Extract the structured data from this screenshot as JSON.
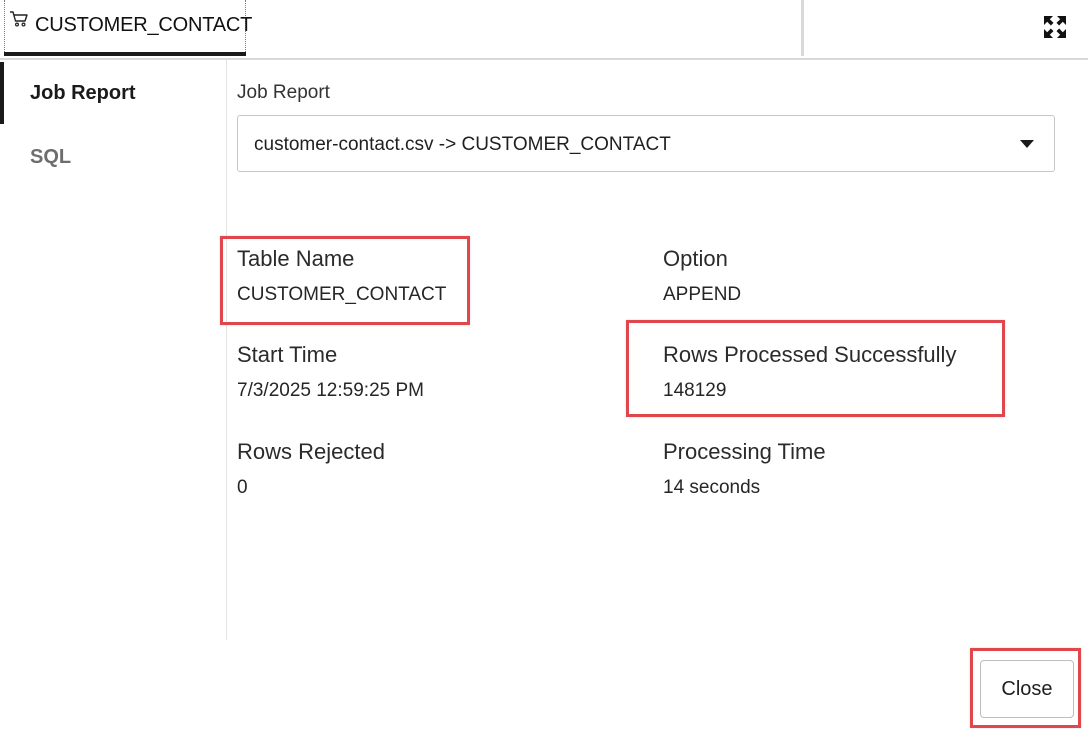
{
  "tab": {
    "icon": "shopping-cart-icon",
    "title": "CUSTOMER_CONTACT"
  },
  "window": {
    "expand_icon": "expand-arrows-icon"
  },
  "sidenav": {
    "items": [
      {
        "label": "Job Report",
        "active": true
      },
      {
        "label": "SQL",
        "active": false
      }
    ]
  },
  "job_report": {
    "select_label": "Job Report",
    "selected_value": "customer-contact.csv -> CUSTOMER_CONTACT"
  },
  "details": {
    "table_name": {
      "label": "Table Name",
      "value": "CUSTOMER_CONTACT"
    },
    "option": {
      "label": "Option",
      "value": "APPEND"
    },
    "start_time": {
      "label": "Start Time",
      "value": "7/3/2025 12:59:25 PM"
    },
    "rows_processed": {
      "label": "Rows Processed Successfully",
      "value": "148129"
    },
    "rows_rejected": {
      "label": "Rows Rejected",
      "value": "0"
    },
    "processing_time": {
      "label": "Processing Time",
      "value": "14 seconds"
    }
  },
  "footer": {
    "close_label": "Close"
  },
  "colors": {
    "highlight": "#e0474c",
    "accent": "#1a1a1a"
  }
}
